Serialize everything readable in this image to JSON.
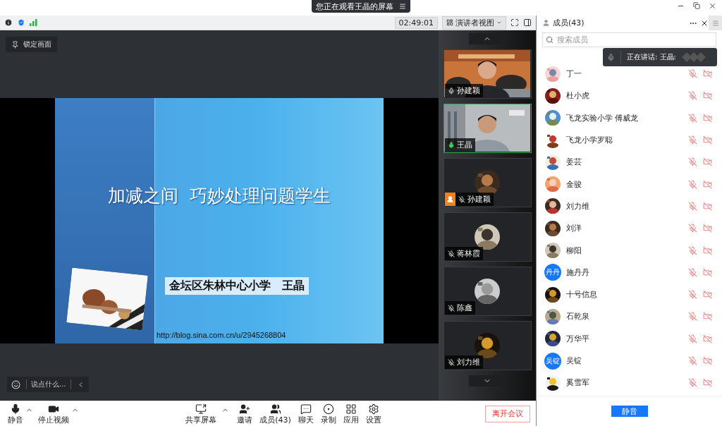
{
  "window": {
    "banner": "您正在观看王晶的屏幕"
  },
  "toolbar": {
    "timer": "02:49:01",
    "view_mode": "演讲者视图"
  },
  "stage": {
    "lock_button": "锁定画面",
    "slide": {
      "title": "加减之间  巧妙处理问题学生",
      "subtitle": "金坛区朱林中心小学　王晶",
      "url": "http://blog.sina.com.cn/u/2945268804"
    },
    "chat_prompt": "说点什么..."
  },
  "video_tiles": [
    {
      "name": "孙建颖",
      "kind": "video",
      "muted": false,
      "speaking": false,
      "host": false,
      "selected": false
    },
    {
      "name": "王晶",
      "kind": "video",
      "muted": false,
      "speaking": true,
      "host": false,
      "selected": true
    },
    {
      "name": "孙建颖",
      "kind": "avatar",
      "muted": true,
      "speaking": false,
      "host": true,
      "selected": false
    },
    {
      "name": "蒋林霞",
      "kind": "avatar",
      "muted": true,
      "speaking": false,
      "host": false,
      "selected": false
    },
    {
      "name": "陈鑫",
      "kind": "avatar",
      "muted": true,
      "speaking": false,
      "host": false,
      "selected": false
    },
    {
      "name": "刘力维",
      "kind": "avatar",
      "muted": true,
      "speaking": false,
      "host": false,
      "selected": false
    }
  ],
  "members_panel": {
    "title": "成员(43)",
    "search": {
      "placeholder": "搜索成员"
    },
    "speaking_notice": "正在讲话: 王晶:",
    "members": [
      {
        "name": "丁一",
        "kind": "picture",
        "mic_muted": true,
        "camera_off": true
      },
      {
        "name": "杜小虎",
        "kind": "picture",
        "mic_muted": true,
        "camera_off": true
      },
      {
        "name": "飞龙实验小学 傅威龙",
        "kind": "picture",
        "mic_muted": true,
        "camera_off": true
      },
      {
        "name": "飞龙小学罗聪",
        "kind": "picture",
        "mic_muted": true,
        "camera_off": true
      },
      {
        "name": "姜芸",
        "kind": "picture",
        "mic_muted": true,
        "camera_off": true
      },
      {
        "name": "金骏",
        "kind": "picture",
        "mic_muted": true,
        "camera_off": true
      },
      {
        "name": "刘力维",
        "kind": "picture",
        "mic_muted": true,
        "camera_off": true
      },
      {
        "name": "刘洋",
        "kind": "picture",
        "mic_muted": true,
        "camera_off": true
      },
      {
        "name": "柳阳",
        "kind": "picture",
        "mic_muted": true,
        "camera_off": true
      },
      {
        "name": "施丹丹",
        "kind": "initials",
        "avatar_text": "丹丹",
        "mic_muted": true,
        "camera_off": true
      },
      {
        "name": "十号信息",
        "kind": "picture",
        "mic_muted": true,
        "camera_off": true
      },
      {
        "name": "石乾泉",
        "kind": "picture",
        "mic_muted": true,
        "camera_off": true
      },
      {
        "name": "万华平",
        "kind": "picture",
        "mic_muted": true,
        "camera_off": true
      },
      {
        "name": "吴锭",
        "kind": "initials",
        "avatar_text": "吴锭",
        "mic_muted": true,
        "camera_off": true
      },
      {
        "name": "奚雪军",
        "kind": "picture",
        "mic_muted": true,
        "camera_off": true
      }
    ],
    "mute_all": "静音"
  },
  "bottom_bar": {
    "left": [
      {
        "label": "静音",
        "caret": true
      },
      {
        "label": "停止视频",
        "caret": true
      }
    ],
    "center": [
      {
        "label": "共享屏幕",
        "caret": true
      },
      {
        "label": "邀请",
        "caret": false
      },
      {
        "label": "成员(43)",
        "caret": false
      },
      {
        "label": "聊天",
        "caret": false
      },
      {
        "label": "录制",
        "caret": false
      },
      {
        "label": "应用",
        "caret": false
      },
      {
        "label": "设置",
        "caret": false
      }
    ],
    "leave": "离开会议"
  }
}
